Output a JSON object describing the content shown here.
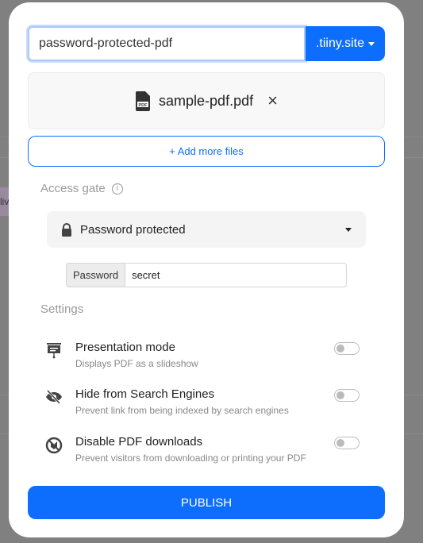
{
  "background": {
    "partial_text": "liv"
  },
  "url": {
    "value": "password-protected-pdf",
    "suffix": ".tiiny.site"
  },
  "file": {
    "name": "sample-pdf.pdf",
    "icon": "pdf-file-icon",
    "remove": "×"
  },
  "add_files": "+ Add more files",
  "access": {
    "heading": "Access gate",
    "info": "i",
    "selected": "Password protected",
    "password_label": "Password",
    "password_value": "secret"
  },
  "settings": {
    "heading": "Settings",
    "options": [
      {
        "title": "Presentation mode",
        "desc": "Displays PDF as a slideshow",
        "icon": "presentation-icon",
        "enabled": false
      },
      {
        "title": "Hide from Search Engines",
        "desc": "Prevent link from being indexed by search engines",
        "icon": "eye-slash-icon",
        "enabled": false
      },
      {
        "title": "Disable PDF downloads",
        "desc": "Prevent visitors from downloading or printing your PDF",
        "icon": "no-download-icon",
        "enabled": false
      }
    ]
  },
  "publish": "PUBLISH",
  "colors": {
    "accent": "#0d6efd",
    "overlay": "#808080"
  }
}
